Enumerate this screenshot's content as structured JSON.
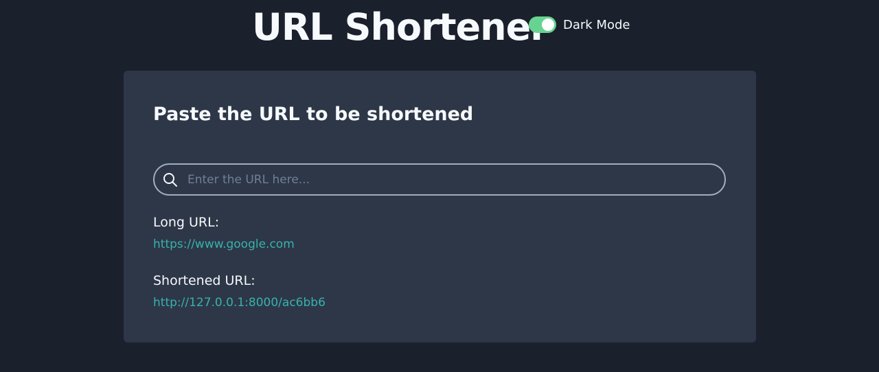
{
  "header": {
    "title": "URL Shortener",
    "dark_mode_label": "Dark Mode",
    "dark_mode_on": true
  },
  "card": {
    "heading": "Paste the URL to be shortened",
    "search": {
      "placeholder": "Enter the URL here...",
      "value": ""
    },
    "long_url": {
      "label": "Long URL:",
      "value": "https://www.google.com"
    },
    "short_url": {
      "label": "Shortened URL:",
      "value": "http://127.0.0.1:8000/ac6bb6"
    }
  },
  "colors": {
    "page_background": "#1a202c",
    "card_background": "#2d3748",
    "toggle_on": "#68d391",
    "link": "#38b2ac",
    "text": "#f7fafc"
  },
  "icons": {
    "search": "search-icon"
  }
}
